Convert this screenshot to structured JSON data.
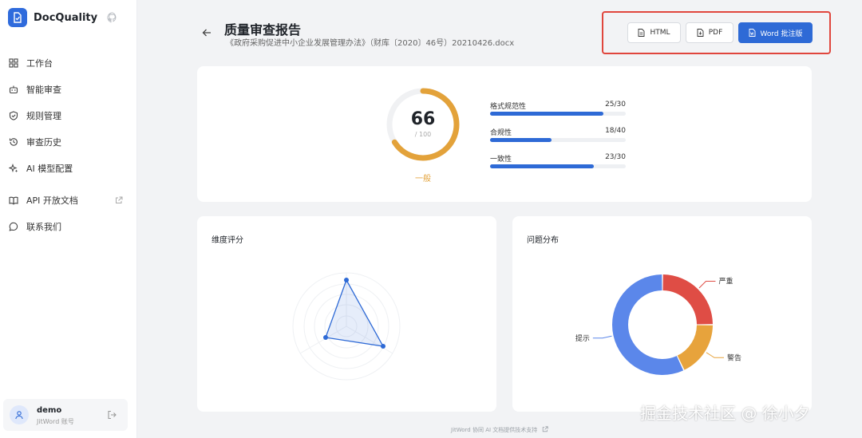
{
  "brand": {
    "name": "DocQuality"
  },
  "sidebar": {
    "items": [
      {
        "label": "工作台",
        "icon": "grid-icon"
      },
      {
        "label": "智能审查",
        "icon": "robot-icon"
      },
      {
        "label": "规则管理",
        "icon": "shield-icon"
      },
      {
        "label": "审查历史",
        "icon": "history-icon"
      },
      {
        "label": "AI 模型配置",
        "icon": "sparkle-icon"
      },
      {
        "label": "API 开放文档",
        "icon": "book-icon"
      },
      {
        "label": "联系我们",
        "icon": "chat-icon"
      }
    ]
  },
  "user": {
    "name": "demo",
    "sub": "JitWord 账号"
  },
  "header": {
    "title": "质量审查报告",
    "file": "《政府采购促进中小企业发展管理办法》（财库〔2020〕46号）20210426.docx"
  },
  "export": {
    "html_label": "HTML",
    "pdf_label": "PDF",
    "word_label": "Word 批注版"
  },
  "score": {
    "value": "66",
    "max": "/ 100",
    "fraction": 0.66,
    "grade": "一般",
    "color": "#e3a23a"
  },
  "metrics": [
    {
      "label": "格式规范性",
      "value": "25/30",
      "fraction": 0.8333
    },
    {
      "label": "合规性",
      "value": "18/40",
      "fraction": 0.45
    },
    {
      "label": "一致性",
      "value": "23/30",
      "fraction": 0.7667
    }
  ],
  "dimension": {
    "title": "维度评分"
  },
  "distribution": {
    "title": "问题分布",
    "slices": [
      {
        "label": "严重",
        "value": 25,
        "color": "#df4d45"
      },
      {
        "label": "警告",
        "value": 18,
        "color": "#e7a33c"
      },
      {
        "label": "提示",
        "value": 57,
        "color": "#5b87ea"
      }
    ]
  },
  "footer": {
    "text": "JitWord 协同 AI 文档提供技术支持"
  },
  "watermark": {
    "text": "掘金技术社区 @ 徐小夕"
  },
  "colors": {
    "accent": "#2e6ad6",
    "highlight_border": "#e0463d"
  }
}
